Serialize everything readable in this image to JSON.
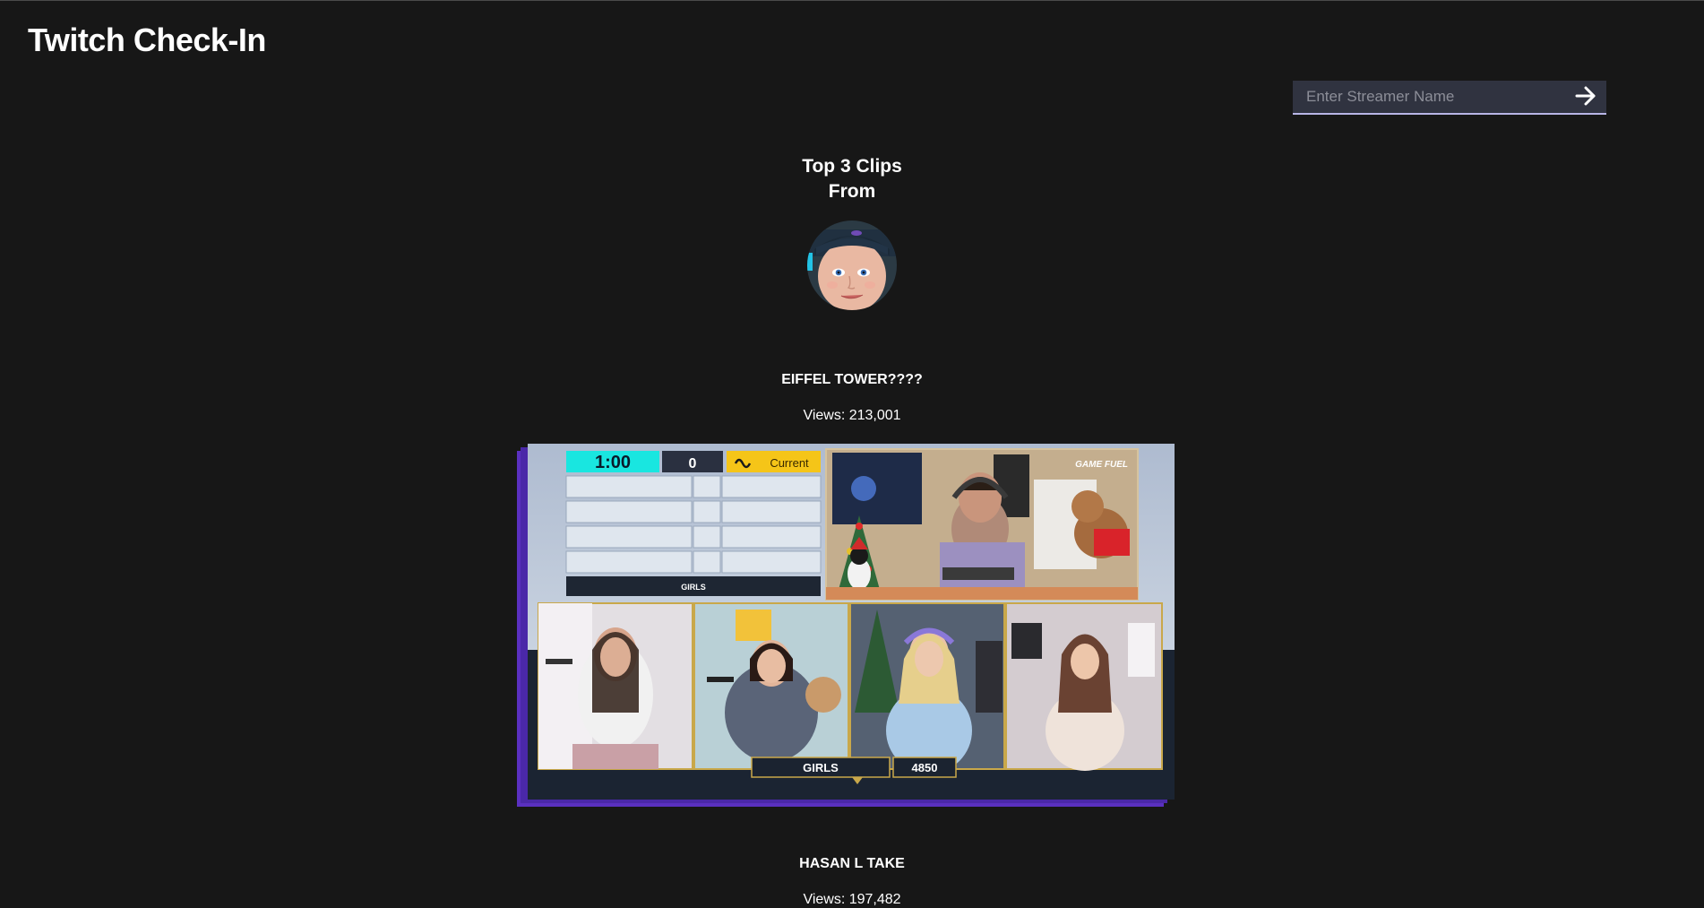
{
  "app": {
    "title": "Twitch Check-In"
  },
  "search": {
    "placeholder": "Enter Streamer Name",
    "value": "",
    "submit_icon": "arrow-right-icon"
  },
  "clips_section": {
    "heading_line1": "Top 3 Clips",
    "heading_line2": "From"
  },
  "clips": [
    {
      "title": "EIFFEL TOWER????",
      "views": "Views: 213,001",
      "thumbnail": {
        "timer": "1:00",
        "score_box": "0",
        "current_label": "Current",
        "board_label": "GIRLS",
        "team_label": "GIRLS",
        "team_score": "4850",
        "watermark": "GAME FUEL"
      }
    },
    {
      "title": "HASAN L TAKE",
      "views": "Views: 197,482"
    }
  ],
  "colors": {
    "background": "#171717",
    "search_bg": "#303340",
    "search_underline": "#b8b5e6",
    "thumb_shadow": "#5a30c0",
    "timer_cyan": "#19e6e0",
    "current_yellow": "#f5c518"
  }
}
